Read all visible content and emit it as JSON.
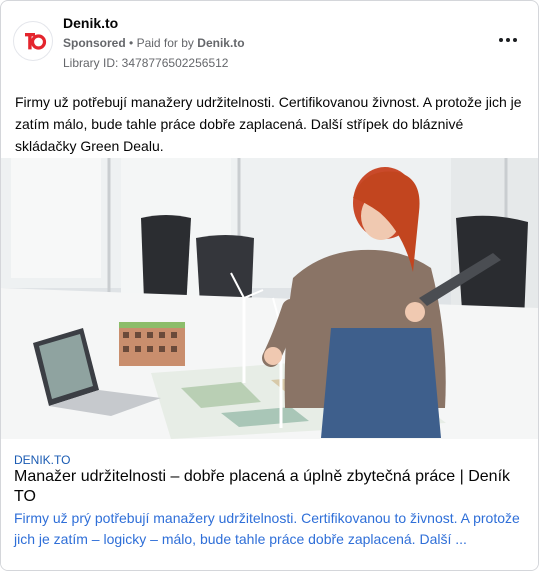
{
  "post": {
    "page_name": "Denik.to",
    "sponsored": "Sponsored",
    "separator": "•",
    "paid_for_by_prefix": "Paid for by",
    "paid_for_by": "Denik.to",
    "library_id": "Library ID: 3478776502256512",
    "body": "Firmy už potřebují manažery udržitelnosti. Certifikovanou živnost. A protože jich je zatím málo, bude tahle práce dobře zaplacená. Další střípek do bláznivé skládačky Green Dealu.",
    "avatar_logo_text": "TO",
    "more_icon": "more-horizontal-icon"
  },
  "link_preview": {
    "domain": "DENIK.TO",
    "headline": "Manažer udržitelnosti – dobře placená a úplně zbytečná práce | Deník TO",
    "description": "Firmy už prý potřebují manažery udržitelnosti. Certifikovanou to živnost. A protože jich je zatím – logicky – málo, bude tahle práce dobře zaplacená. Další ..."
  },
  "colors": {
    "brand_red": "#e4252d",
    "link_blue": "#2f6fd8",
    "meta_gray": "#65676b"
  }
}
